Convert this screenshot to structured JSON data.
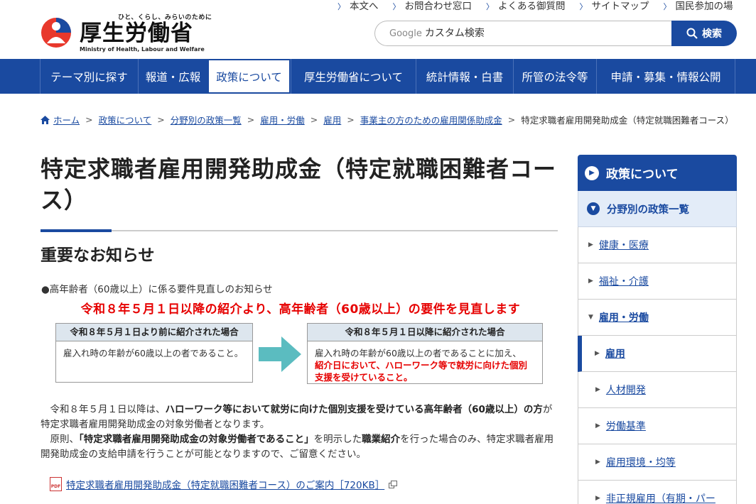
{
  "header": {
    "logo_tagline": "ひと、くらし、みらいのために",
    "logo_name": "厚生労働省",
    "logo_english": "Ministry of Health, Labour and Welfare",
    "utility_links": [
      "本文へ",
      "お問合わせ窓口",
      "よくある御質問",
      "サイトマップ",
      "国民参加の場"
    ],
    "search_brand": "Google",
    "search_placeholder": "カスタム検索",
    "search_button": "検索"
  },
  "nav": {
    "items": [
      "テーマ別に探す",
      "報道・広報",
      "政策について",
      "厚生労働省について",
      "統計情報・白書",
      "所管の法令等",
      "申請・募集・情報公開"
    ],
    "active_index": 2
  },
  "breadcrumb": {
    "home": "ホーム",
    "links": [
      "政策について",
      "分野別の政策一覧",
      "雇用・労働",
      "雇用",
      "事業主の方のための雇用関係助成金"
    ],
    "current": "特定求職者雇用開発助成金（特定就職困難者コース）"
  },
  "main": {
    "title": "特定求職者雇用開発助成金（特定就職困難者コース）",
    "section_heading": "重要なお知らせ",
    "notice_line": "●高年齢者（60歳以上）に係る要件見直しのお知らせ",
    "banner": "令和８年５月１日以降の紹介より、高年齢者（60歳以上）の要件を見直します",
    "box_before": {
      "heading": "令和８年５月１日より前に紹介された場合",
      "body": "雇入れ時の年齢が60歳以上の者であること。"
    },
    "box_after": {
      "heading": "令和８年５月１日以降に紹介された場合",
      "body": "雇入れ時の年齢が60歳以上の者であることに加え、",
      "body_red": "紹介日において、ハローワーク等で就労に向けた個別支援を受けていること。"
    },
    "para1_a": "令和８年５月１日以降は、",
    "para1_b": "ハローワーク等において就労に向けた個別支援を受けている高年齢者（60歳以上）の方",
    "para1_c": "が特定求職者雇用開発助成金の対象労働者となります。",
    "para2_a": "原則、",
    "para2_b": "「特定求職者雇用開発助成金の対象労働者であること」",
    "para2_c": "を明示した",
    "para2_d": "職業紹介",
    "para2_e": "を行った場合のみ、特定求職者雇用開発助成金の支給申請を行うことが可能となりますので、ご留意ください。",
    "pdf_icon_label": "PDF",
    "pdf_link": "特定求職者雇用開発助成金（特定就職困難者コース）のご案内［720KB］"
  },
  "sidebar": {
    "heading": "政策について",
    "sub_heading": "分野別の政策一覧",
    "items": [
      {
        "label": "健康・医療",
        "level": 1,
        "state": "closed"
      },
      {
        "label": "福祉・介護",
        "level": 1,
        "state": "closed"
      },
      {
        "label": "雇用・労働",
        "level": 1,
        "state": "open"
      },
      {
        "label": "雇用",
        "level": 2,
        "state": "current"
      },
      {
        "label": "人材開発",
        "level": 2,
        "state": "closed"
      },
      {
        "label": "労働基準",
        "level": 2,
        "state": "closed"
      },
      {
        "label": "雇用環境・均等",
        "level": 2,
        "state": "closed"
      },
      {
        "label": "非正規雇用（有期・パー",
        "level": 2,
        "state": "closed"
      }
    ]
  },
  "colors": {
    "brand_blue": "#1a4aa0",
    "alert_red": "#e60000",
    "logo_red": "#e8382c",
    "logo_blue": "#1a4aa0"
  }
}
